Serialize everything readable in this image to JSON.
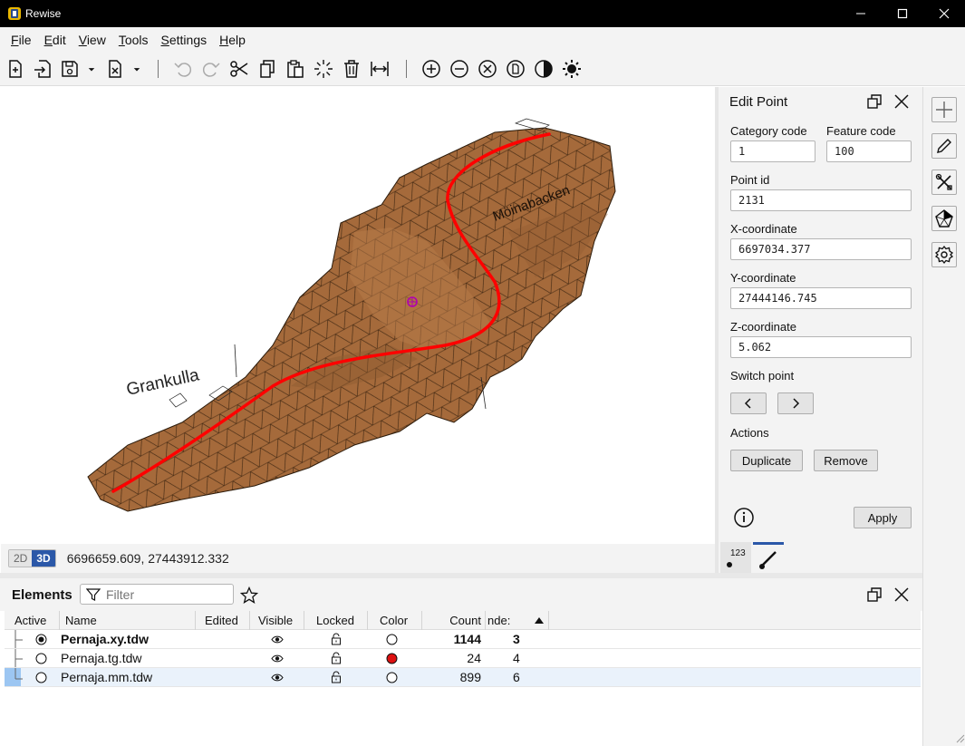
{
  "window": {
    "app_title": "Rewise",
    "logo_icon": "rewise-logo-icon",
    "controls": [
      "minimize-icon",
      "maximize-icon",
      "close-icon"
    ]
  },
  "menu": [
    {
      "label": "File",
      "accel": "F"
    },
    {
      "label": "Edit",
      "accel": "E"
    },
    {
      "label": "View",
      "accel": "V"
    },
    {
      "label": "Tools",
      "accel": "T"
    },
    {
      "label": "Settings",
      "accel": "S"
    },
    {
      "label": "Help",
      "accel": "H"
    }
  ],
  "toolbar_icons": [
    "new-file-icon",
    "import-icon",
    "save-icon",
    "save-dropdown-icon",
    "close-file-icon",
    "close-dropdown-icon",
    "undo-icon",
    "redo-icon",
    "cut-icon",
    "copy-icon",
    "paste-icon",
    "select-icon",
    "delete-icon",
    "measure-icon",
    "zoom-in-icon",
    "zoom-out-icon",
    "zoom-fit-icon",
    "zoom-page-icon",
    "contrast-icon",
    "brightness-icon"
  ],
  "viewport": {
    "labels": {
      "left": "Grankulla",
      "right": "Möinabacken"
    },
    "mode_2d": "2D",
    "mode_3d": "3D",
    "active_mode": "3D",
    "cursor_coords": "6696659.609, 27443912.332",
    "terrain_color": "#a56a3b",
    "line_color": "#ff0000"
  },
  "edit_point": {
    "title": "Edit Point",
    "category_code_label": "Category code",
    "category_code": "1",
    "feature_code_label": "Feature code",
    "feature_code": "100",
    "point_id_label": "Point id",
    "point_id": "2131",
    "x_label": "X-coordinate",
    "x_value": "6697034.377",
    "y_label": "Y-coordinate",
    "y_value": "27444146.745",
    "z_label": "Z-coordinate",
    "z_value": "5.062",
    "switch_label": "Switch point",
    "actions_label": "Actions",
    "duplicate_label": "Duplicate",
    "remove_label": "Remove",
    "apply_label": "Apply",
    "tab_numeric_label": "123"
  },
  "sidebar_icons": [
    "add-icon",
    "pencil-icon",
    "tools-icon",
    "polygon-icon",
    "settings-icon"
  ],
  "elements": {
    "title": "Elements",
    "filter_placeholder": "Filter",
    "columns": [
      "Active",
      "Name",
      "Edited",
      "Visible",
      "Locked",
      "Color",
      "Count",
      "nde:"
    ],
    "rows": [
      {
        "name": "Pernaja.xy.tdw",
        "active": true,
        "bold": true,
        "color": "#ffffff",
        "count": "1144",
        "index": "3"
      },
      {
        "name": "Pernaja.tg.tdw",
        "active": false,
        "bold": false,
        "color": "#dd1111",
        "count": "24",
        "index": "4"
      },
      {
        "name": "Pernaja.mm.tdw",
        "active": false,
        "bold": false,
        "color": "#ffffff",
        "count": "899",
        "index": "6"
      }
    ]
  }
}
